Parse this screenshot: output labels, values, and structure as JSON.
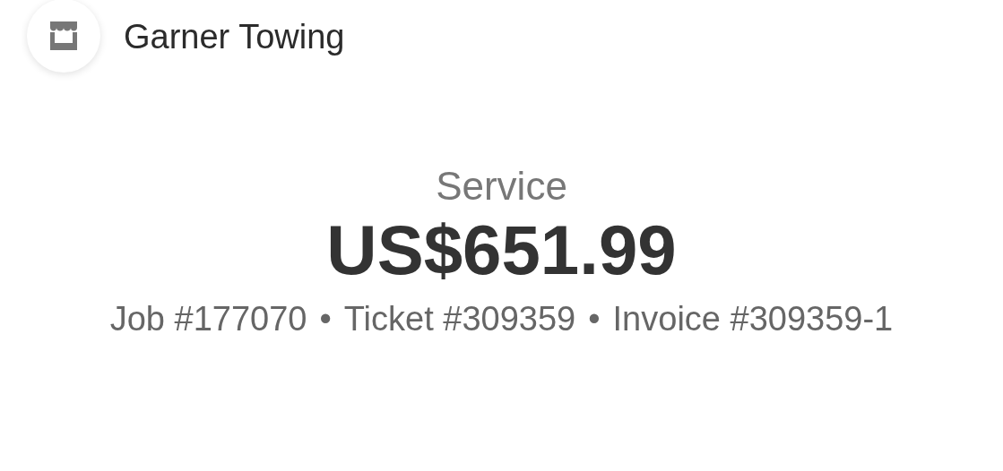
{
  "merchant": {
    "name": "Garner Towing"
  },
  "payment": {
    "label": "Service",
    "amount": "US$651.99"
  },
  "references": [
    "Job #177070",
    "Ticket #309359",
    "Invoice #309359-1"
  ],
  "separator": "•"
}
